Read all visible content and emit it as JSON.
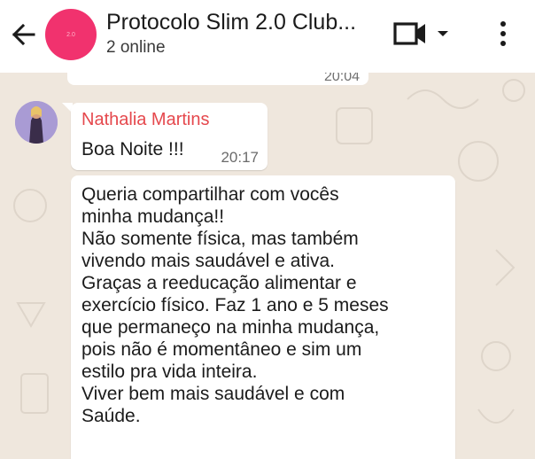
{
  "header": {
    "title": "Protocolo Slim 2.0 Club...",
    "subtitle": "2 online",
    "avatar_text": "2.0",
    "icons": {
      "back": "back-arrow-icon",
      "video": "video-camera-icon",
      "dropdown": "caret-down-icon",
      "menu": "more-vertical-icon"
    }
  },
  "chat": {
    "previous_message_time": "20:04",
    "messages": [
      {
        "sender": "Nathalia Martins",
        "text": "Boa Noite !!!",
        "time": "20:17"
      },
      {
        "lines": [
          "Queria compartilhar com vocês",
          "minha mudança!!",
          "Não somente física, mas também",
          "vivendo mais saudável e ativa.",
          "Graças a reeducação alimentar e",
          "exercício físico. Faz 1 ano e 5 meses",
          "que permaneço na minha mudança,",
          "pois não é momentâneo e sim um",
          "estilo pra vida inteira.",
          "Viver bem mais saudável e com",
          "Saúde."
        ]
      }
    ]
  },
  "colors": {
    "header_bg": "#ffffff",
    "chat_bg": "#efe7dd",
    "group_avatar": "#f1326e",
    "sender_name": "#e5484d"
  }
}
